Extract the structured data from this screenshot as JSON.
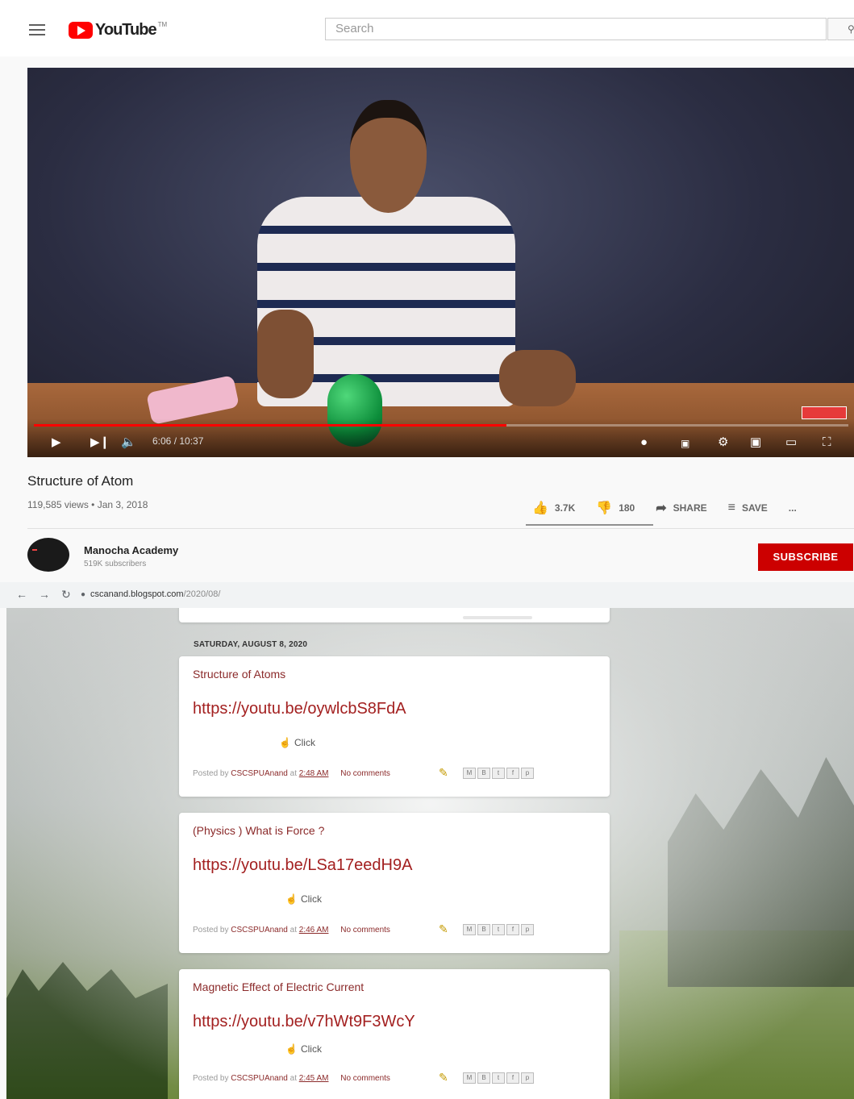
{
  "youtube": {
    "logo_text": "YouTube",
    "logo_tm": "TM",
    "search_placeholder": "Search",
    "player": {
      "time": "6:06 / 10:37",
      "progress": 0.58
    },
    "video": {
      "title": "Structure of Atom",
      "meta": "119,585 views • Jan 3, 2018",
      "likes": "3.7K",
      "dislikes": "180",
      "share_label": "SHARE",
      "save_label": "SAVE",
      "more_label": "..."
    },
    "channel": {
      "name": "Manocha Academy",
      "subs": "519K subscribers",
      "subscribe_label": "SUBSCRIBE"
    }
  },
  "browser": {
    "url_host": "cscanand.blogspot.com",
    "url_path": "/2020/08/"
  },
  "blog": {
    "date_header": "SATURDAY, AUGUST 8, 2020",
    "posts": [
      {
        "title": "Structure of Atoms",
        "link": "https://youtu.be/oywlcbS8FdA",
        "click": "Click",
        "posted_by_prefix": "Posted by",
        "author": "CSCSPUAnand",
        "at": "at",
        "time": "2:48 AM",
        "comments": "No comments"
      },
      {
        "title": "(Physics ) What is Force ?",
        "link": "https://youtu.be/LSa17eedH9A",
        "click": "Click",
        "posted_by_prefix": "Posted by",
        "author": "CSCSPUAnand",
        "at": "at",
        "time": "2:46 AM",
        "comments": "No comments"
      },
      {
        "title": "Magnetic Effect of Electric Current",
        "link": "https://youtu.be/v7hWt9F3WcY",
        "click": "Click",
        "posted_by_prefix": "Posted by",
        "author": "CSCSPUAnand",
        "at": "at",
        "time": "2:45 AM",
        "comments": "No comments"
      }
    ],
    "share_icons": [
      "M",
      "B",
      "t",
      "f",
      "p"
    ]
  },
  "colors": {
    "youtube_red": "#ff0000",
    "subscribe_red": "#cc0000",
    "blog_link": "#a32020"
  }
}
